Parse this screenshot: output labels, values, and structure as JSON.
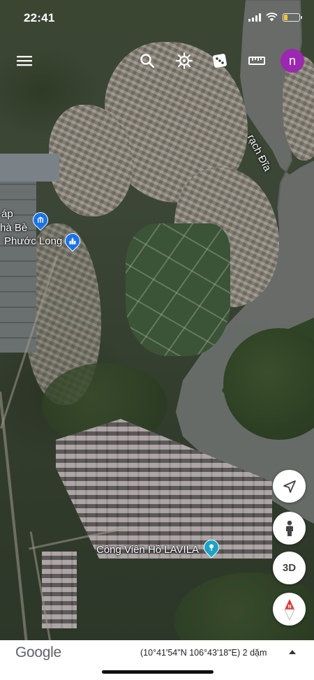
{
  "status_bar": {
    "time": "22:41",
    "battery_color": "#f4c430"
  },
  "toolbar": {
    "menu_icon": "hamburger-menu-icon",
    "search_icon": "search-icon",
    "voyager_icon": "ship-wheel-icon",
    "feeling_lucky_icon": "dice-icon",
    "measure_icon": "ruler-icon",
    "avatar_initial": "n",
    "avatar_color": "#9c27b0"
  },
  "map": {
    "labels": {
      "cap_label": "áp",
      "nha_be_label": "hà Bè",
      "phuoc_long_label": "Phước Long",
      "river_label": "rạch Đĩa",
      "park_label": "Công Viên Hồ LAVILA"
    }
  },
  "controls": {
    "location_icon": "navigation-arrow-icon",
    "street_view_icon": "pegman-icon",
    "three_d_label": "3D",
    "compass_icon": "compass-icon"
  },
  "bottom_bar": {
    "logo_text": "Google",
    "coordinates": "(10°41'54\"N 106°43'18\"E)",
    "scale": "2 dặm"
  }
}
